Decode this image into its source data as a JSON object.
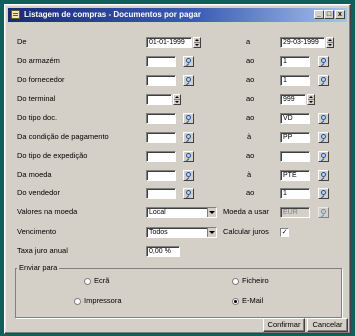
{
  "window": {
    "title": "Listagem de compras - Documentos por pagar",
    "min_glyph": "_",
    "max_glyph": "□",
    "close_glyph": "x"
  },
  "rows": {
    "de": {
      "label": "De",
      "from": "01-01-1999",
      "sep": "a",
      "to": "29-03-1999"
    },
    "armazem": {
      "label": "Do armazém",
      "from": "",
      "sep": "ao",
      "to": "1"
    },
    "fornecedor": {
      "label": "Do fornecedor",
      "from": "",
      "sep": "ao",
      "to": "1"
    },
    "terminal": {
      "label": "Do terminal",
      "from": "",
      "sep": "ao",
      "to": "999"
    },
    "tipo_doc": {
      "label": "Do tipo doc.",
      "from": "",
      "sep": "ao",
      "to": "VD"
    },
    "cond_pagamento": {
      "label": "Da condição de pagamento",
      "from": "",
      "sep": "à",
      "to": "PP"
    },
    "tipo_expedicao": {
      "label": "Do tipo de expedição",
      "from": "",
      "sep": "ao",
      "to": ""
    },
    "moeda": {
      "label": "Da moeda",
      "from": "",
      "sep": "à",
      "to": "PTE"
    },
    "vendedor": {
      "label": "Do vendedor",
      "from": "",
      "sep": "ao",
      "to": "1"
    }
  },
  "valores_moeda": {
    "label": "Valores na moeda",
    "value": "Local"
  },
  "moeda_usar": {
    "label": "Moeda a usar",
    "value": "EUR"
  },
  "vencimento": {
    "label": "Vencimento",
    "value": "Todos"
  },
  "calcular_juros": {
    "label": "Calcular juros",
    "checked": true,
    "mark": "✓"
  },
  "taxa_juro": {
    "label": "Taxa juro anual",
    "value": "0,00 %"
  },
  "enviar_para": {
    "title": "Enviar para",
    "options": [
      {
        "label": "Ecrã",
        "selected": false
      },
      {
        "label": "Ficheiro",
        "selected": false
      },
      {
        "label": "Impressora",
        "selected": false
      },
      {
        "label": "E-Mail",
        "selected": true
      }
    ]
  },
  "buttons": {
    "confirm": "Confirmar",
    "cancel": "Cancelar"
  },
  "colors": {
    "desktop": "#0f5f5c",
    "face": "#d4d0c8",
    "title_start": "#1a2a78",
    "title_end": "#a8c3ea"
  }
}
